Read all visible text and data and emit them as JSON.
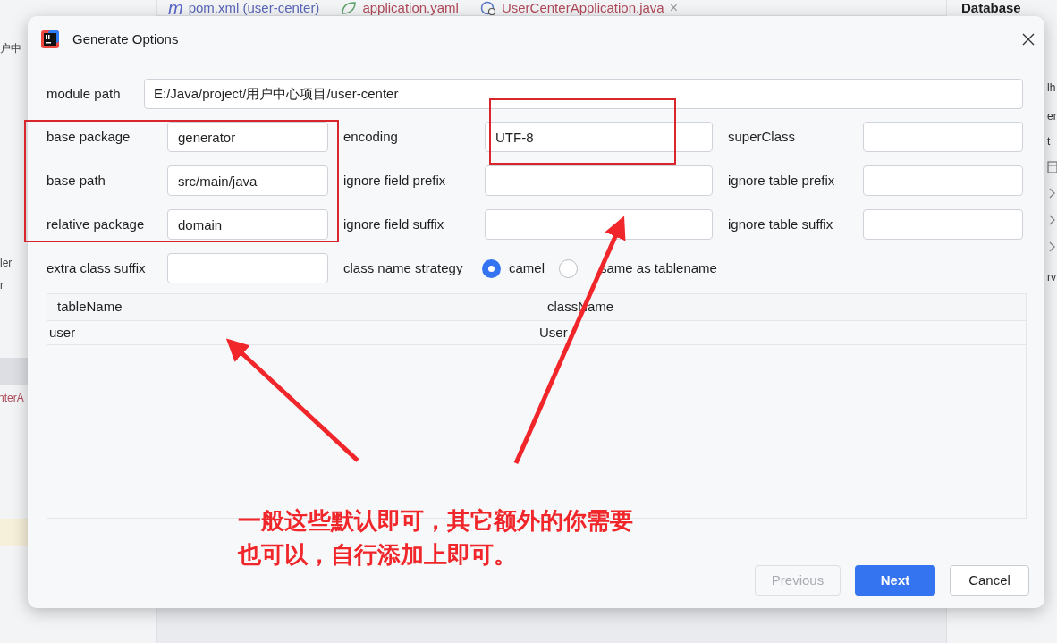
{
  "editor_tabs": [
    {
      "icon_glyph": "m",
      "label": "pom.xml (user-center)",
      "kind": "maven"
    },
    {
      "label": "application.yaml",
      "kind": "yaml"
    },
    {
      "label": "UserCenterApplication.java",
      "kind": "java",
      "close": "×"
    }
  ],
  "tool_window": {
    "title": "Database",
    "fragments": [
      "lh",
      "er",
      "t",
      "rv"
    ]
  },
  "project_fragments": [
    {
      "text": "户中",
      "kind": "plain"
    },
    {
      "text": "ler",
      "kind": "plain"
    },
    {
      "text": "r",
      "kind": "plain"
    },
    {
      "text": "nterA",
      "kind": "file"
    }
  ],
  "dialog": {
    "title": "Generate Options",
    "module_path": {
      "label": "module path",
      "value": "E:/Java/project/用户中心项目/user-center"
    },
    "fields": [
      {
        "label": "base package",
        "value": "generator"
      },
      {
        "label": "encoding",
        "value": "UTF-8"
      },
      {
        "label": "superClass"
      },
      {
        "label": "base path",
        "value": "src/main/java"
      },
      {
        "label": "ignore field prefix"
      },
      {
        "label": "ignore table prefix"
      },
      {
        "label": "relative package",
        "value": "domain"
      },
      {
        "label": "ignore field suffix"
      },
      {
        "label": "ignore table suffix"
      },
      {
        "label": "extra class suffix"
      }
    ],
    "strategy": {
      "label": "class name strategy",
      "options": [
        {
          "label": "camel",
          "selected": true
        },
        {
          "label": "same as tablename",
          "selected": false
        }
      ]
    },
    "table": {
      "columns": [
        "tableName",
        "className"
      ],
      "rows": [
        [
          "user",
          "User"
        ]
      ]
    },
    "buttons": [
      {
        "label": "Previous",
        "disabled": true,
        "primary": false
      },
      {
        "label": "Next",
        "disabled": false,
        "primary": true
      },
      {
        "label": "Cancel",
        "disabled": false,
        "primary": false
      }
    ]
  },
  "annotation": {
    "lines": [
      "一般这些默认即可，其它额外的你需要",
      "也可以，自行添加上即可。"
    ]
  }
}
